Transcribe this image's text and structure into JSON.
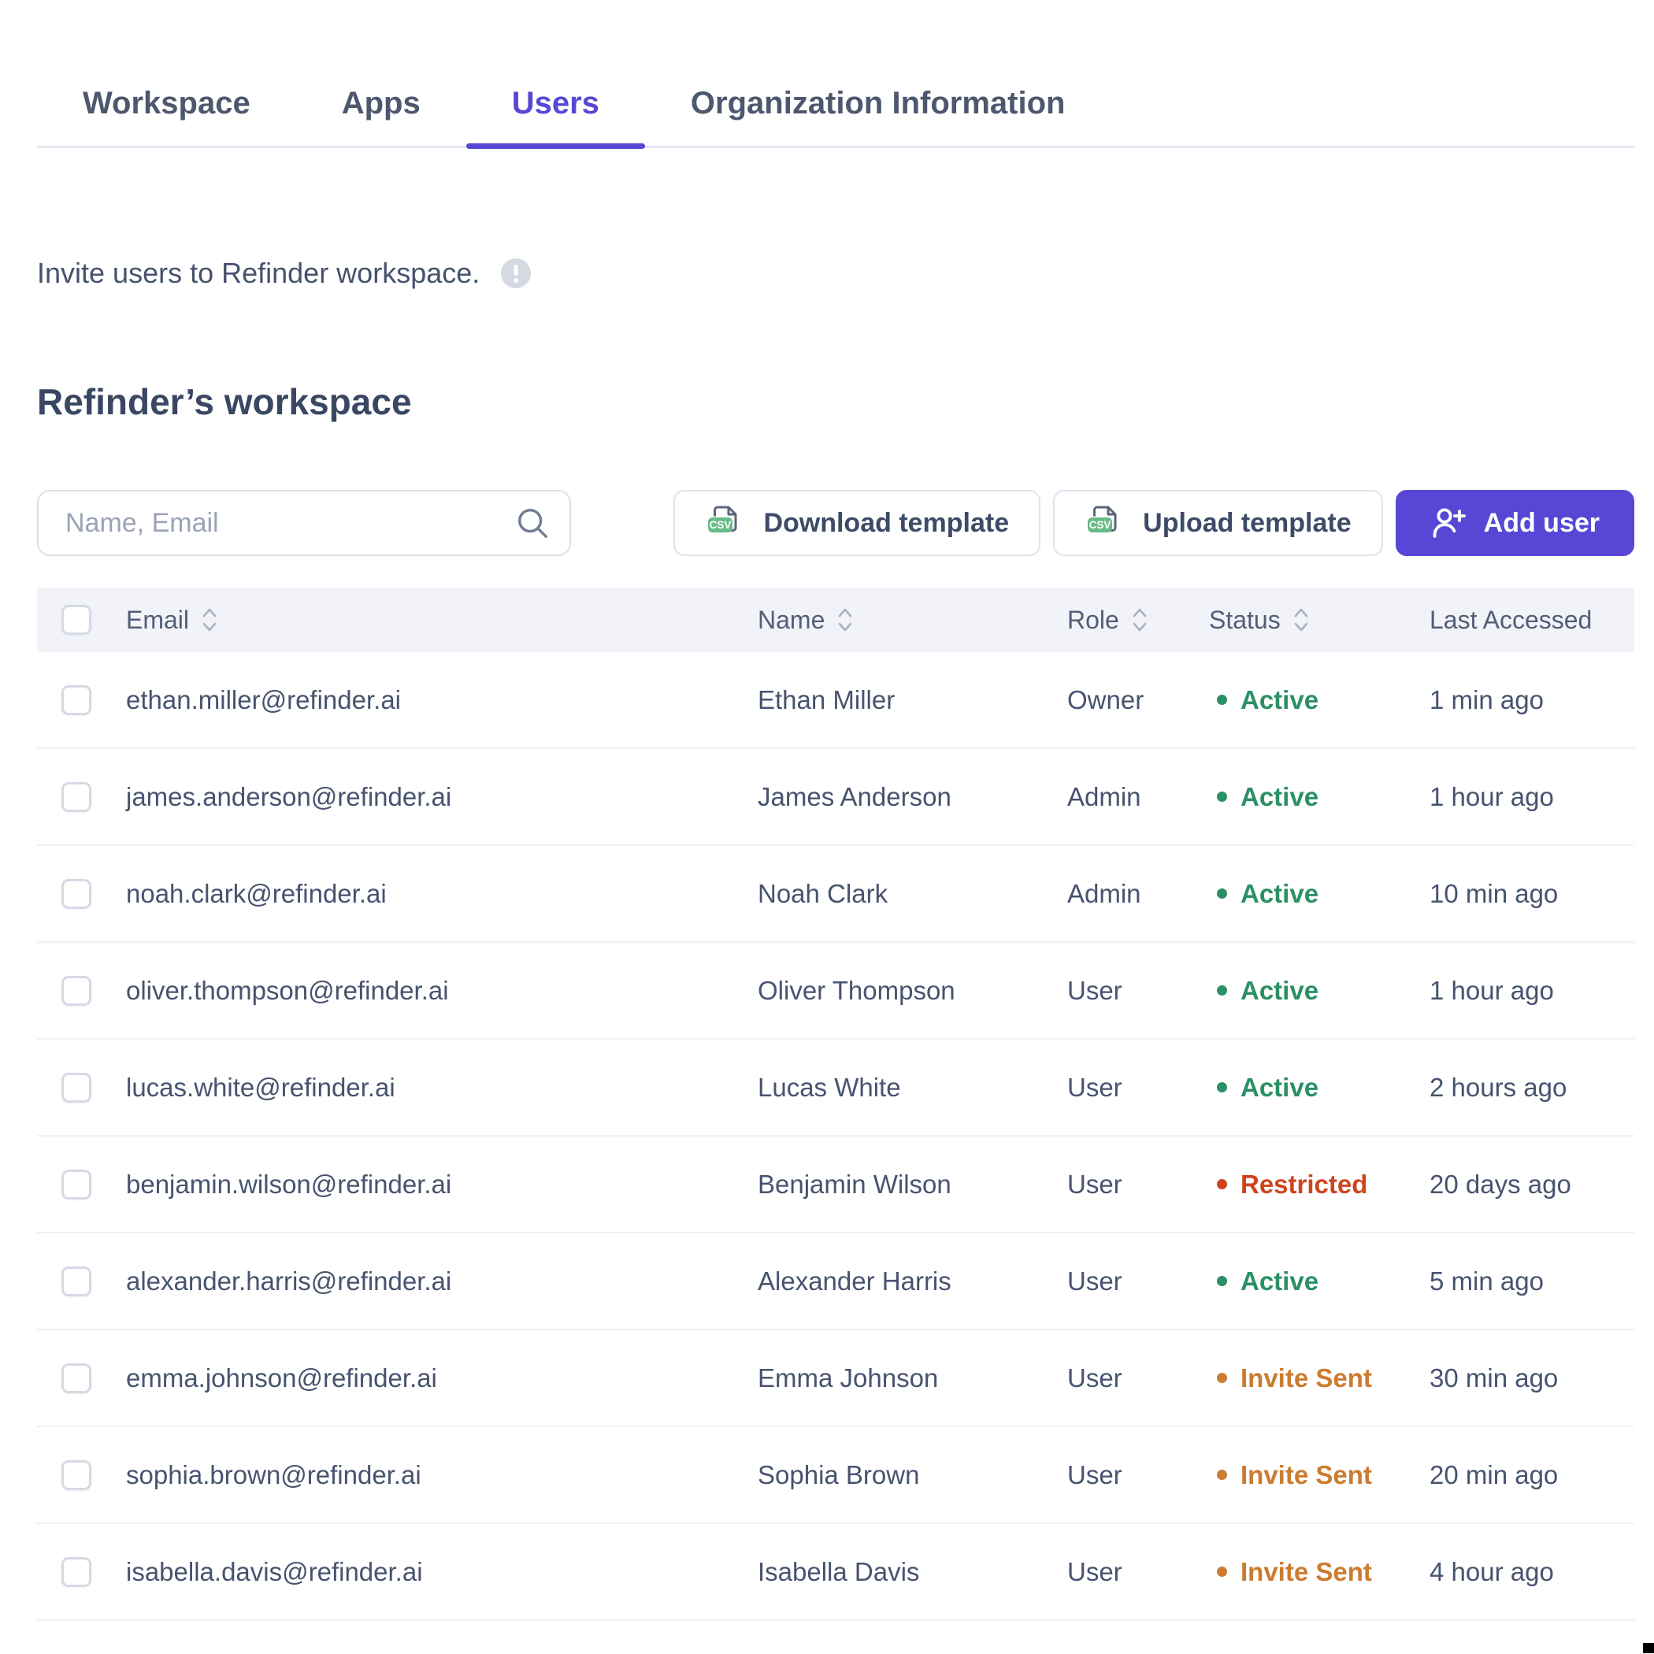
{
  "tabs": [
    {
      "label": "Workspace",
      "active": false
    },
    {
      "label": "Apps",
      "active": false
    },
    {
      "label": "Users",
      "active": true
    },
    {
      "label": "Organization Information",
      "active": false
    }
  ],
  "intro": {
    "text": "Invite users to Refinder workspace.",
    "info_icon": "info-circle-icon"
  },
  "workspace": {
    "title": "Refinder’s workspace"
  },
  "toolbar": {
    "search_placeholder": "Name, Email",
    "search_icon": "search-icon",
    "download_template_label": "Download template",
    "upload_template_label": "Upload template",
    "add_user_label": "Add user",
    "csv_icon": "csv-file-icon",
    "add_user_icon": "person-plus-icon"
  },
  "table": {
    "columns": [
      {
        "label": "Email",
        "sortable": true
      },
      {
        "label": "Name",
        "sortable": true
      },
      {
        "label": "Role",
        "sortable": true
      },
      {
        "label": "Status",
        "sortable": true
      },
      {
        "label": "Last Accessed",
        "sortable": false
      }
    ],
    "rows": [
      {
        "email": "ethan.miller@refinder.ai",
        "name": "Ethan Miller",
        "role": "Owner",
        "status": "Active",
        "status_key": "active",
        "last_accessed": "1 min ago"
      },
      {
        "email": "james.anderson@refinder.ai",
        "name": "James Anderson",
        "role": "Admin",
        "status": "Active",
        "status_key": "active",
        "last_accessed": "1 hour ago"
      },
      {
        "email": "noah.clark@refinder.ai",
        "name": "Noah Clark",
        "role": "Admin",
        "status": "Active",
        "status_key": "active",
        "last_accessed": "10 min ago"
      },
      {
        "email": "oliver.thompson@refinder.ai",
        "name": "Oliver Thompson",
        "role": "User",
        "status": "Active",
        "status_key": "active",
        "last_accessed": "1 hour ago"
      },
      {
        "email": "lucas.white@refinder.ai",
        "name": "Lucas White",
        "role": "User",
        "status": "Active",
        "status_key": "active",
        "last_accessed": "2 hours ago"
      },
      {
        "email": "benjamin.wilson@refinder.ai",
        "name": "Benjamin Wilson",
        "role": "User",
        "status": "Restricted",
        "status_key": "restricted",
        "last_accessed": "20 days ago"
      },
      {
        "email": "alexander.harris@refinder.ai",
        "name": "Alexander Harris",
        "role": "User",
        "status": "Active",
        "status_key": "active",
        "last_accessed": "5 min ago"
      },
      {
        "email": "emma.johnson@refinder.ai",
        "name": "Emma Johnson",
        "role": "User",
        "status": "Invite Sent",
        "status_key": "invite_sent",
        "last_accessed": "30 min ago"
      },
      {
        "email": "sophia.brown@refinder.ai",
        "name": "Sophia Brown",
        "role": "User",
        "status": "Invite Sent",
        "status_key": "invite_sent",
        "last_accessed": "20 min ago"
      },
      {
        "email": "isabella.davis@refinder.ai",
        "name": "Isabella Davis",
        "role": "User",
        "status": "Invite Sent",
        "status_key": "invite_sent",
        "last_accessed": "4 hour ago"
      }
    ]
  },
  "colors": {
    "accent": "#5847d6",
    "status_active": "#2b9066",
    "status_restricted": "#cf441f",
    "status_invite_sent": "#cb7c30",
    "csv_badge": "#68bb88"
  }
}
